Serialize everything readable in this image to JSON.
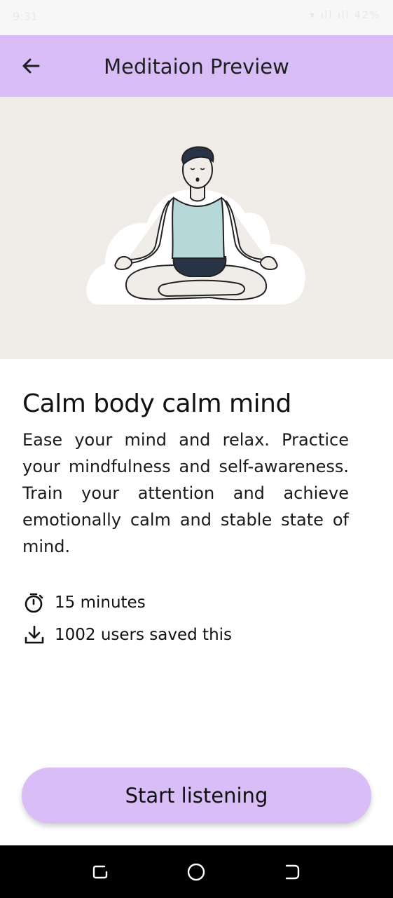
{
  "status_bar": {
    "time": "9:31",
    "icons_text": "▾ ıll ıll 42%"
  },
  "app_bar": {
    "back_icon": "arrow-left-icon",
    "title": "Meditaion Preview"
  },
  "hero": {
    "illustration": "meditating-person-illustration"
  },
  "content": {
    "headline": "Calm body  calm mind",
    "description": "Ease your mind and relax. Practice your mindfulness and self-awareness. Train your attention and achieve emotionally calm and stable state of mind."
  },
  "meta": {
    "duration": {
      "icon": "stopwatch-icon",
      "text": "15 minutes"
    },
    "saves": {
      "icon": "download-icon",
      "text": "1002 users saved this"
    }
  },
  "cta": {
    "label": "Start listening"
  },
  "nav_bar": {
    "recent_icon": "recent-apps-icon",
    "home_icon": "home-icon",
    "back_icon": "back-icon"
  },
  "colors": {
    "accent": "#d8bdf7",
    "hero_bg": "#f0ece8",
    "text": "#111111"
  }
}
